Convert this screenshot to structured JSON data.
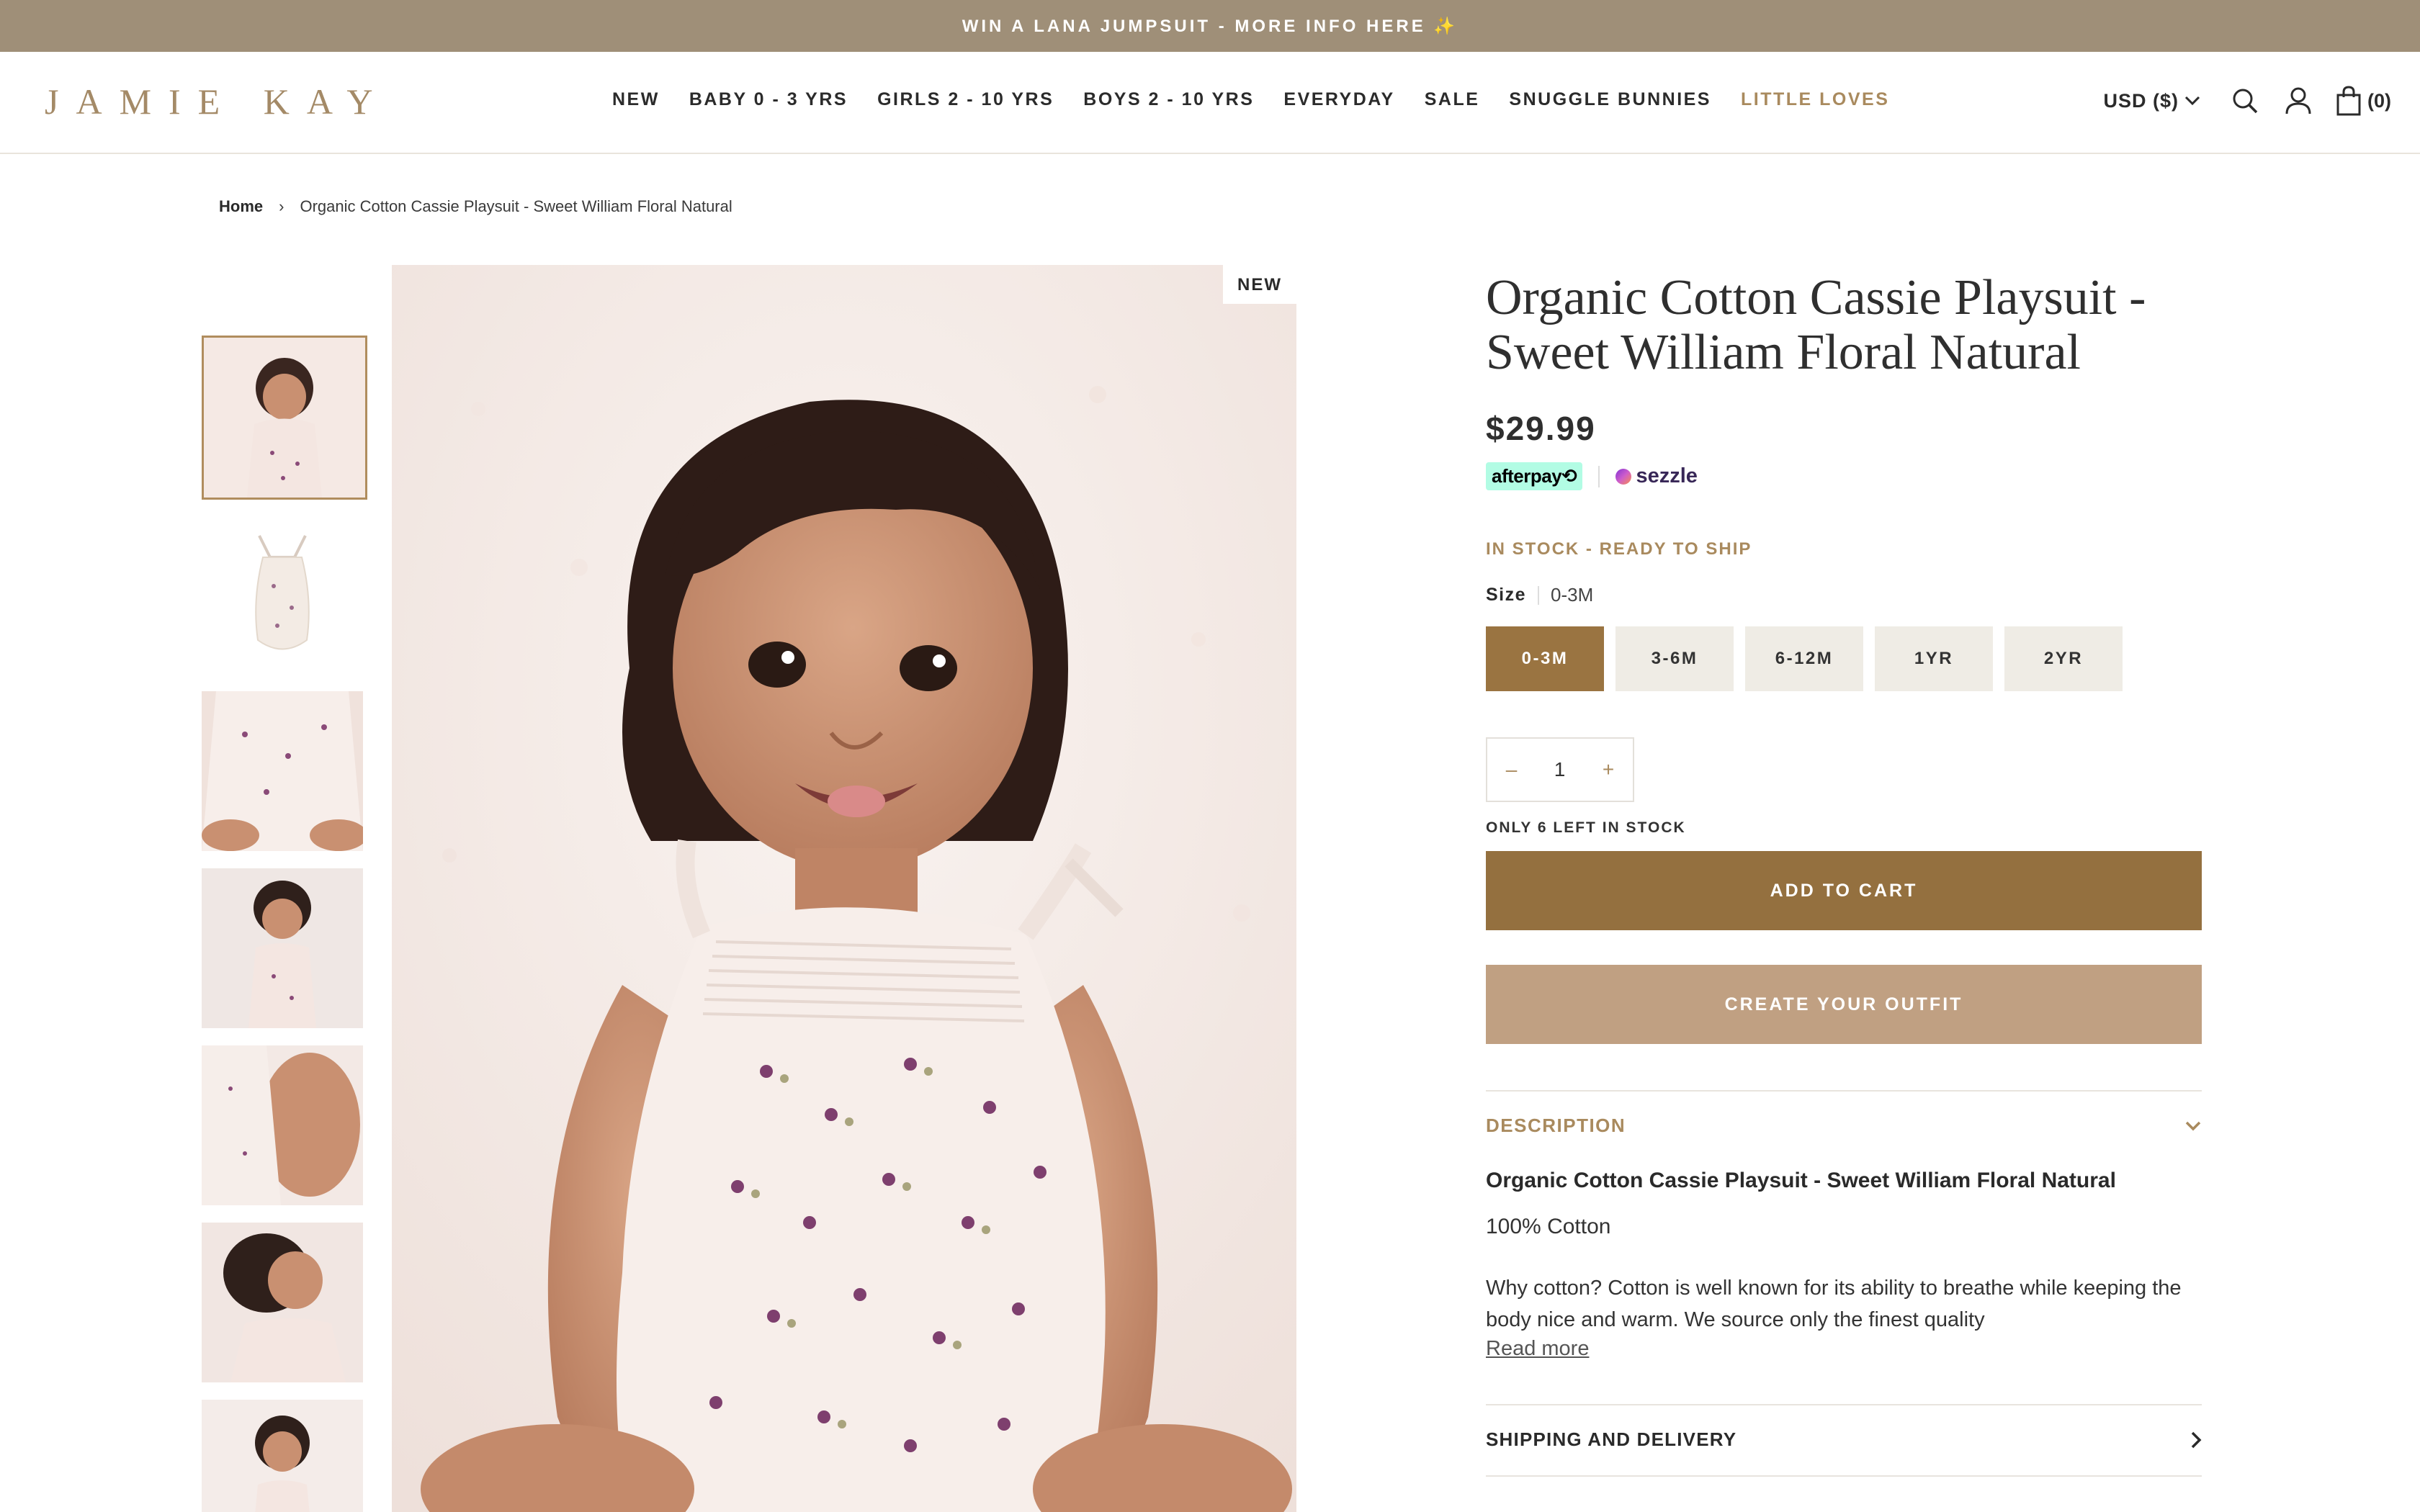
{
  "announcement": {
    "text": "WIN A LANA JUMPSUIT - MORE INFO HERE ✨"
  },
  "header": {
    "logo": "JAMIE KAY",
    "nav": [
      {
        "label": "NEW"
      },
      {
        "label": "BABY 0 - 3 YRS"
      },
      {
        "label": "GIRLS 2 - 10 YRS"
      },
      {
        "label": "BOYS 2 - 10 YRS"
      },
      {
        "label": "EVERYDAY"
      },
      {
        "label": "SALE"
      },
      {
        "label": "SNUGGLE BUNNIES"
      },
      {
        "label": "LITTLE LOVES"
      }
    ],
    "currency": "USD ($)",
    "cart_count": "(0)",
    "icons": [
      "search-icon",
      "account-icon",
      "bag-icon"
    ]
  },
  "breadcrumb": {
    "home": "Home",
    "separator": "›",
    "current": "Organic Cotton Cassie Playsuit - Sweet William Floral Natural"
  },
  "gallery": {
    "badge": "NEW",
    "thumbnail_count": 7
  },
  "product": {
    "title": "Organic Cotton Cassie Playsuit - Sweet William Floral Natural",
    "price": "$29.99",
    "afterpay": "afterpay⟲",
    "sezzle": "sezzle",
    "stock_status": "IN STOCK - READY TO SHIP",
    "size_label": "Size",
    "size_value": "0-3M",
    "sizes": [
      {
        "label": "0-3M",
        "selected": true
      },
      {
        "label": "3-6M",
        "selected": false
      },
      {
        "label": "6-12M",
        "selected": false
      },
      {
        "label": "1YR",
        "selected": false
      },
      {
        "label": "2YR",
        "selected": false
      }
    ],
    "quantity": {
      "minus": "–",
      "value": "1",
      "plus": "+"
    },
    "low_stock": "ONLY 6 LEFT IN STOCK",
    "add_to_cart": "ADD TO CART",
    "create_outfit": "CREATE YOUR OUTFIT"
  },
  "description": {
    "heading": "DESCRIPTION",
    "title": "Organic Cotton Cassie Playsuit - Sweet William Floral Natural",
    "material": "100% Cotton",
    "body": "Why cotton? Cotton is well known for its ability to breathe while keeping the body nice and warm. We source only the finest quality",
    "read_more": "Read more"
  },
  "shipping": {
    "heading": "SHIPPING AND DELIVERY"
  },
  "colors": {
    "announcement_bg": "#9f8f78",
    "brand_gold": "#a98a5e",
    "primary_button": "#94703f",
    "secondary_button": "#c0a082",
    "size_selected": "#9a7441",
    "size_default": "#efece5"
  }
}
